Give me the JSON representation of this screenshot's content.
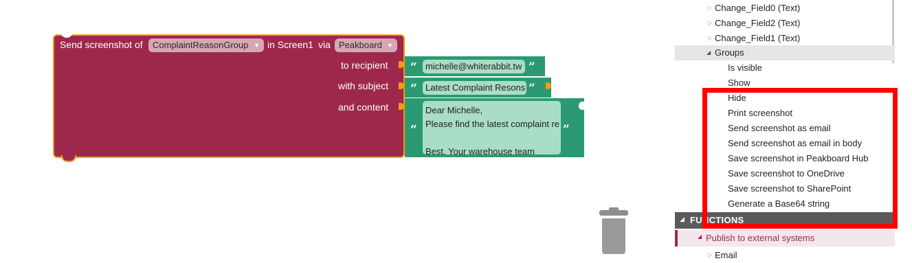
{
  "workspace": {
    "block": {
      "prefix": "Send screenshot of",
      "group_value": "ComplaintReasonGroup",
      "mid": "in Screen1",
      "via": "via",
      "target_value": "Peakboard",
      "recipient_label": "to recipient",
      "subject_label": "with subject",
      "content_label": "and content",
      "recipient_value": "michelle@whiterabbit.tw",
      "subject_value": "Latest Complaint Resons",
      "content_value": "Dear Michelle,\nPlease find the latest complaint re\n\nBest, Your warehouse team",
      "open_quote": "“",
      "close_quote": "”"
    },
    "colors": {
      "block": "#9e284c",
      "text_block": "#2b9a72",
      "highlight": "#f39c12"
    }
  },
  "toolbox": {
    "items_top": [
      {
        "label": "Change_Field0 (Text)"
      },
      {
        "label": "Change_Field2 (Text)"
      },
      {
        "label": "Change_Field1 (Text)"
      }
    ],
    "groups_label": "Groups",
    "group_items": [
      "Is visible",
      "Show",
      "Hide",
      "Print screenshot",
      "Send screenshot as email",
      "Send screenshot as email in body",
      "Save screenshot in Peakboard Hub",
      "Save screenshot to OneDrive",
      "Save screenshot to SharePoint",
      "Generate a Base64 string"
    ],
    "functions_label": "FUNCTIONS",
    "publish_label": "Publish to external systems",
    "email_label": "Email"
  }
}
